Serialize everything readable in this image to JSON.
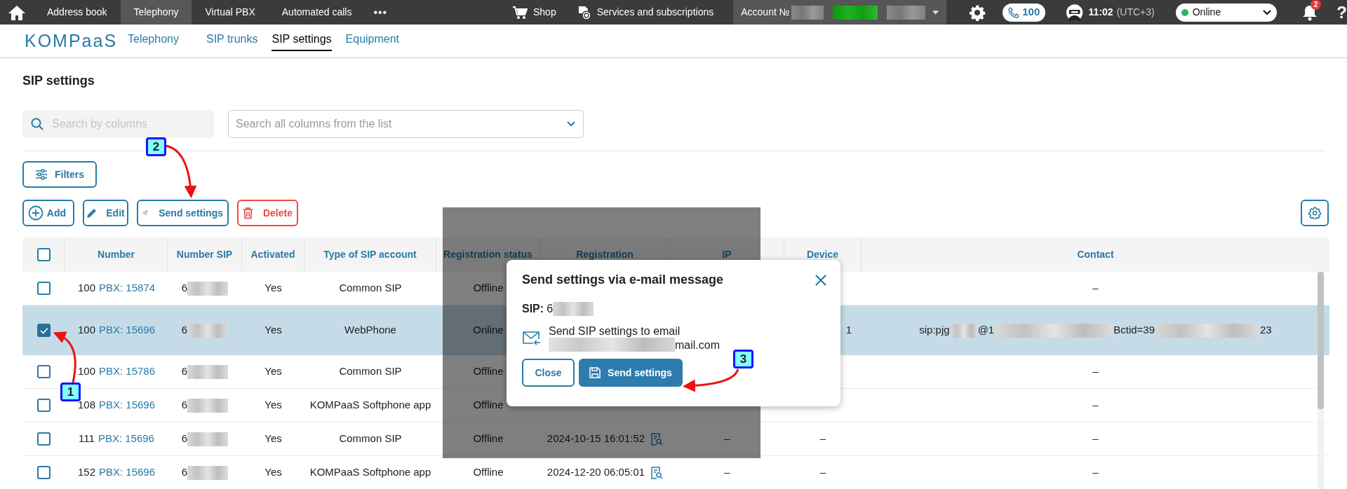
{
  "top_bar": {
    "menu": [
      {
        "label": "Address book",
        "selected": false
      },
      {
        "label": "Telephony",
        "selected": true
      },
      {
        "label": "Virtual PBX",
        "selected": false
      },
      {
        "label": "Automated calls",
        "selected": false
      }
    ],
    "more": "•••",
    "shop": "Shop",
    "services": "Services and subscriptions",
    "account": "Account №",
    "phone_count": "100",
    "time": "11:02",
    "timezone": "(UTC+3)",
    "status": {
      "value": "Online",
      "color": "#2bb560"
    },
    "notifications": "2",
    "help": "?"
  },
  "logo": "KOMPaaS",
  "nav": [
    {
      "label": "Telephony",
      "selected": false
    },
    {
      "label": "SIP trunks",
      "selected": false
    },
    {
      "label": "SIP settings",
      "selected": true
    },
    {
      "label": "Equipment",
      "selected": false
    }
  ],
  "page_title": "SIP settings",
  "search": {
    "placeholder": "Search by columns"
  },
  "column_filter": {
    "placeholder": "Search all columns from the list"
  },
  "filters_button": "Filters",
  "actions": [
    {
      "label": "Add",
      "kind": "add"
    },
    {
      "label": "Edit",
      "kind": "edit"
    },
    {
      "label": "Send settings",
      "kind": "send"
    },
    {
      "label": "Delete",
      "kind": "delete"
    }
  ],
  "table": {
    "all_checked": false,
    "columns": [
      "Number",
      "Number SIP",
      "Activated",
      "Type of SIP account",
      "Registration status",
      "Registration",
      "IP",
      "Device",
      "Contact"
    ],
    "rows": [
      {
        "checked": false,
        "number": "100",
        "pbx": "PBX: 15874",
        "number_sip": "6",
        "activated": "Yes",
        "type": "Common SIP",
        "registration_status": "Offline",
        "contact": "–"
      },
      {
        "checked": true,
        "number": "100",
        "pbx": "PBX: 15696",
        "number_sip": "6",
        "activated": "Yes",
        "type": "WebPhone",
        "registration_status": "Online",
        "device": "1",
        "contact_parts": [
          "sip:pjg",
          "@1",
          "Bctid=39",
          "23"
        ]
      },
      {
        "checked": false,
        "number": "100",
        "pbx": "PBX: 15786",
        "number_sip": "6",
        "activated": "Yes",
        "type": "Common SIP",
        "registration_status": "Offline",
        "contact": "–"
      },
      {
        "checked": false,
        "number": "108",
        "pbx": "PBX: 15696",
        "number_sip": "6",
        "activated": "Yes",
        "type": "KOMPaaS Softphone app",
        "registration_status": "Offline",
        "contact": "–"
      },
      {
        "checked": false,
        "number": "111",
        "pbx": "PBX: 15696",
        "number_sip": "6",
        "activated": "Yes",
        "type": "Common SIP",
        "registration_status": "Offline",
        "registration": "2024-10-15 16:01:52",
        "ip": "–",
        "device": "–",
        "contact": "–"
      },
      {
        "checked": false,
        "number": "152",
        "pbx": "PBX: 15696",
        "number_sip": "6",
        "activated": "Yes",
        "type": "KOMPaaS Softphone app",
        "registration_status": "Offline",
        "registration": "2024-12-20 06:05:01",
        "ip": "–",
        "device": "–",
        "contact": "–"
      }
    ]
  },
  "dialog": {
    "title": "Send settings via e-mail message",
    "sip_label": "SIP:",
    "sip_value": "6",
    "message": "Send SIP settings to email",
    "email_visible": "mail.com",
    "buttons": [
      {
        "label": "Close",
        "kind": "secondary"
      },
      {
        "label": "Send settings",
        "kind": "primary"
      }
    ]
  },
  "annotations": [
    "1",
    "2",
    "3"
  ]
}
